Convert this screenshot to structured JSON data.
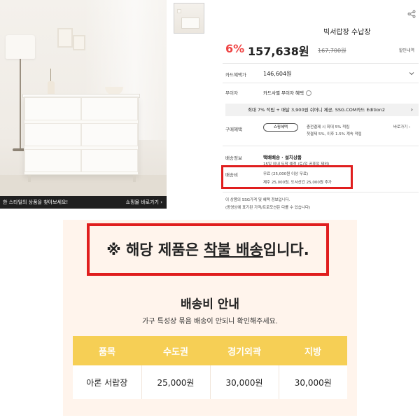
{
  "product": {
    "banner_text": "한 스타일의 상품을 찾아보세요!",
    "banner_link": "쇼핑몰 바로가기",
    "title": "빅서랍장 수납장",
    "discount": "6%",
    "price": "157,638원",
    "original_price": "167,700원",
    "discount_info": "할인내역",
    "card_label": "카드혜택가",
    "card_price": "146,604원",
    "interest_label": "무이자",
    "interest_value": "카드사별 무이자 혜택",
    "benefit_bar": "최대 7% 적립 + 매달 3,900원 쉬어니 제공, SSG.COM카드 Edition2",
    "purchase_label": "구매혜택",
    "membership_button": "쇼핑혜택",
    "purchase_line1": "충전결제 시 최대 5% 적립",
    "purchase_line2": "첫결제 5%, 이후 1.5% 계속 적립",
    "purchase_more": "바로가기",
    "shipping_label": "배송정보",
    "shipping_type": "택배배송 · 설치상품",
    "shipping_eta": "15일 이내 도착 예정 (토/일 공휴일 제외)",
    "fee_label": "배송비",
    "fee_free": "무료 (25,000원 이상 무료)",
    "fee_island": "제주 25,000원, 도서산간 25,000원 추가",
    "note1": "이 상품의 SSG가격 및 혜택 정보입니다.",
    "note2": "(동영상에 표기된 가격/프로모션은 다를 수 있습니다)"
  },
  "notice": {
    "prefix": "※ 해당 제품은 ",
    "highlight": "착불 배송",
    "suffix": "입니다.",
    "fee_title": "배송비 안내",
    "fee_subtitle": "가구 특성상 묶음 배송이 안되니 확인해주세요.",
    "table_headers": [
      "품목",
      "수도권",
      "경기외곽",
      "지방"
    ],
    "table_row": [
      "아론 서랍장",
      "25,000원",
      "30,000원",
      "30,000원"
    ]
  },
  "colors": {
    "accent_red": "#e01e1e",
    "discount_red": "#ef4444",
    "table_header": "#f6cf55",
    "notice_bg": "#fff4ec"
  },
  "icons": [
    "share-icon",
    "chevron-down-icon",
    "info-circle-icon",
    "chevron-right-icon"
  ]
}
